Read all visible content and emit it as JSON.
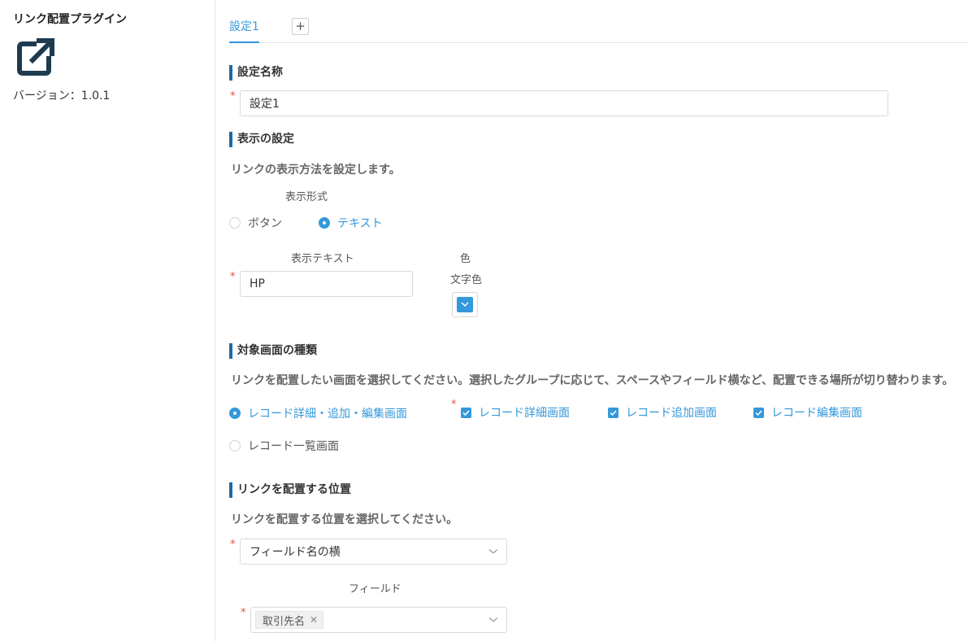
{
  "plugin": {
    "title": "リンク配置プラグイン",
    "version": "バージョン：1.0.1",
    "logo_icon": "external-link-icon"
  },
  "tabs": {
    "items": [
      {
        "label": "設定1",
        "active": true
      }
    ],
    "add_label": "+"
  },
  "setting_name": {
    "heading": "設定名称",
    "value": "設定1"
  },
  "display": {
    "heading": "表示の設定",
    "description": "リンクの表示方法を設定します。",
    "format_label": "表示形式",
    "options": [
      {
        "label": "ボタン",
        "selected": false
      },
      {
        "label": "テキスト",
        "selected": true
      }
    ],
    "text_label": "表示テキスト",
    "text_value": "HP",
    "color_label": "色",
    "text_color_label": "文字色",
    "text_color_value": "#3498db"
  },
  "target_screen": {
    "heading": "対象画面の種類",
    "description": "リンクを配置したい画面を選択してください。選択したグループに応じて、スペースやフィールド横など、配置できる場所が切り替わります。",
    "groups": [
      {
        "label": "レコード詳細・追加・編集画面",
        "selected": true
      },
      {
        "label": "レコード一覧画面",
        "selected": false
      }
    ],
    "screens": [
      {
        "label": "レコード詳細画面",
        "checked": true
      },
      {
        "label": "レコード追加画面",
        "checked": true
      },
      {
        "label": "レコード編集画面",
        "checked": true
      }
    ]
  },
  "position": {
    "heading": "リンクを配置する位置",
    "description": "リンクを配置する位置を選択してください。",
    "selected_option": "フィールド名の横",
    "field_label": "フィールド",
    "field_tags": [
      "取引先名"
    ]
  },
  "colors": {
    "accent": "#3498db",
    "heading_bar": "#1d6aa5",
    "required": "#e74c3c",
    "logo": "#1e3a4f"
  }
}
